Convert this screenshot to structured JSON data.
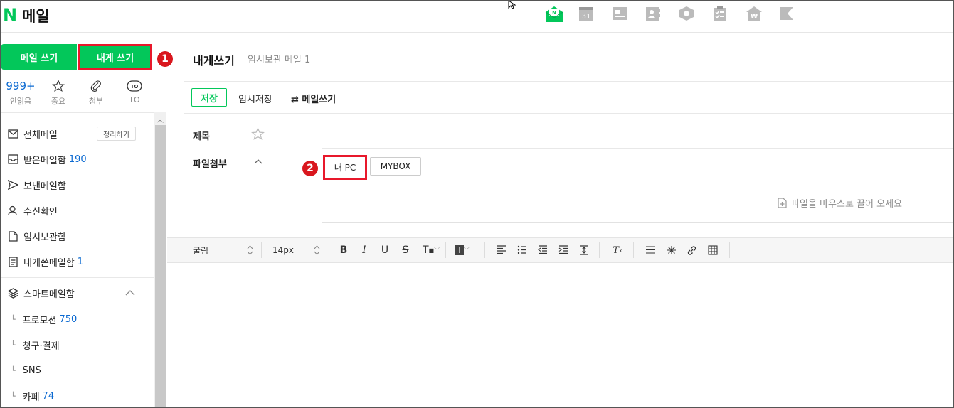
{
  "app": {
    "logo_letter": "N",
    "logo_text": "메일"
  },
  "header_apps": [
    {
      "icon": "mail-icon",
      "color": "#03c75a"
    },
    {
      "icon": "calendar-icon",
      "label": "31"
    },
    {
      "icon": "memo-icon"
    },
    {
      "icon": "contacts-icon"
    },
    {
      "icon": "box-icon"
    },
    {
      "icon": "todo-icon"
    },
    {
      "icon": "pay-icon"
    },
    {
      "icon": "bookmark-icon"
    }
  ],
  "sidebar": {
    "compose_label": "메일 쓰기",
    "self_compose_label": "내게 쓰기",
    "marker1": "1",
    "quick": [
      {
        "value": "999+",
        "label": "안읽음"
      },
      {
        "icon": "star-icon",
        "label": "중요"
      },
      {
        "icon": "clip-icon",
        "label": "첨부"
      },
      {
        "badge": "TO",
        "label": "TO"
      }
    ],
    "folders": [
      {
        "label": "전체메일",
        "count": "",
        "icon": "envelope-icon"
      },
      {
        "label": "받은메일함",
        "count": "190",
        "icon": "inbox-icon"
      },
      {
        "label": "보낸메일함",
        "count": "",
        "icon": "send-icon"
      },
      {
        "label": "수신확인",
        "count": "",
        "icon": "receipt-icon"
      },
      {
        "label": "임시보관함",
        "count": "",
        "icon": "draft-icon"
      },
      {
        "label": "내게쓴메일함",
        "count": "1",
        "icon": "self-icon"
      }
    ],
    "tidy_label": "정리하기",
    "smart_label": "스마트메일함",
    "smart_items": [
      {
        "label": "프로모션",
        "count": "750"
      },
      {
        "label": "청구·결제",
        "count": ""
      },
      {
        "label": "SNS",
        "count": ""
      },
      {
        "label": "카페",
        "count": "74"
      }
    ]
  },
  "compose": {
    "title": "내게쓰기",
    "subtitle": "임시보관 메일 1",
    "save_label": "저장",
    "draft_label": "임시저장",
    "switch_label": "메일쓰기",
    "subject_label": "제목",
    "attach_label": "파일첨부",
    "marker2": "2",
    "mypc_label": "내 PC",
    "mybox_label": "MYBOX",
    "drop_text": "파일을 마우스로 끌어 오세요",
    "accent": "#03c75a",
    "highlight": "#e8182b"
  },
  "toolbar": {
    "font": "굴림",
    "size": "14px"
  }
}
